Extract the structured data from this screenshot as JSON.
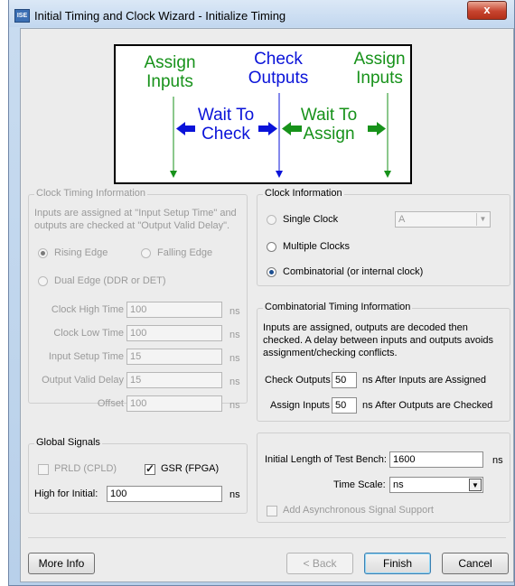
{
  "window": {
    "title": "Initial Timing and Clock Wizard - Initialize Timing",
    "icon_text": "ISE",
    "close_label": "x"
  },
  "diagram": {
    "assign_inputs": "Assign Inputs",
    "check_outputs": "Check Outputs",
    "assign_inputs_right": "Assign Inputs",
    "wait_to_check": "Wait To Check",
    "wait_to_assign": "Wait To Assign"
  },
  "clock_timing": {
    "legend": "Clock Timing Information",
    "description": "Inputs are assigned at \"Input Setup Time\" and outputs are checked at \"Output Valid Delay\".",
    "rising_edge": "Rising Edge",
    "falling_edge": "Falling Edge",
    "dual_edge": "Dual Edge (DDR or DET)",
    "rows": [
      {
        "label": "Clock High Time",
        "value": "100",
        "unit": "ns"
      },
      {
        "label": "Clock Low Time",
        "value": "100",
        "unit": "ns"
      },
      {
        "label": "Input Setup Time",
        "value": "15",
        "unit": "ns"
      },
      {
        "label": "Output Valid Delay",
        "value": "15",
        "unit": "ns"
      },
      {
        "label": "Offset",
        "value": "100",
        "unit": "ns"
      }
    ]
  },
  "clock_info": {
    "legend": "Clock Information",
    "single_clock": "Single Clock",
    "single_clock_value": "A",
    "multiple_clocks": "Multiple Clocks",
    "combinatorial": "Combinatorial (or internal clock)",
    "selected": "combinatorial"
  },
  "comb_timing": {
    "legend": "Combinatorial Timing Information",
    "description": "Inputs are assigned, outputs are decoded then checked.  A delay between inputs and outputs avoids assignment/checking conflicts.",
    "check_outputs_label": "Check Outputs",
    "check_outputs_value": "50",
    "check_outputs_after": "ns  After Inputs are Assigned",
    "assign_inputs_label": "Assign Inputs",
    "assign_inputs_value": "50",
    "assign_inputs_after": "ns  After Outputs are Checked"
  },
  "global_signals": {
    "legend": "Global Signals",
    "prld": "PRLD (CPLD)",
    "prld_checked": false,
    "gsr": "GSR (FPGA)",
    "gsr_checked": true,
    "high_for_initial_label": "High for Initial:",
    "high_for_initial_value": "100",
    "unit": "ns"
  },
  "test_bench": {
    "initial_length_label": "Initial Length of Test Bench:",
    "initial_length_value": "1600",
    "unit": "ns",
    "time_scale_label": "Time Scale:",
    "time_scale_value": "ns",
    "async_label": "Add Asynchronous Signal Support",
    "async_checked": false
  },
  "buttons": {
    "more_info": "More Info",
    "back": "< Back",
    "finish": "Finish",
    "cancel": "Cancel"
  },
  "colors": {
    "diagram_green": "#17921a",
    "diagram_blue": "#0a13d9"
  }
}
